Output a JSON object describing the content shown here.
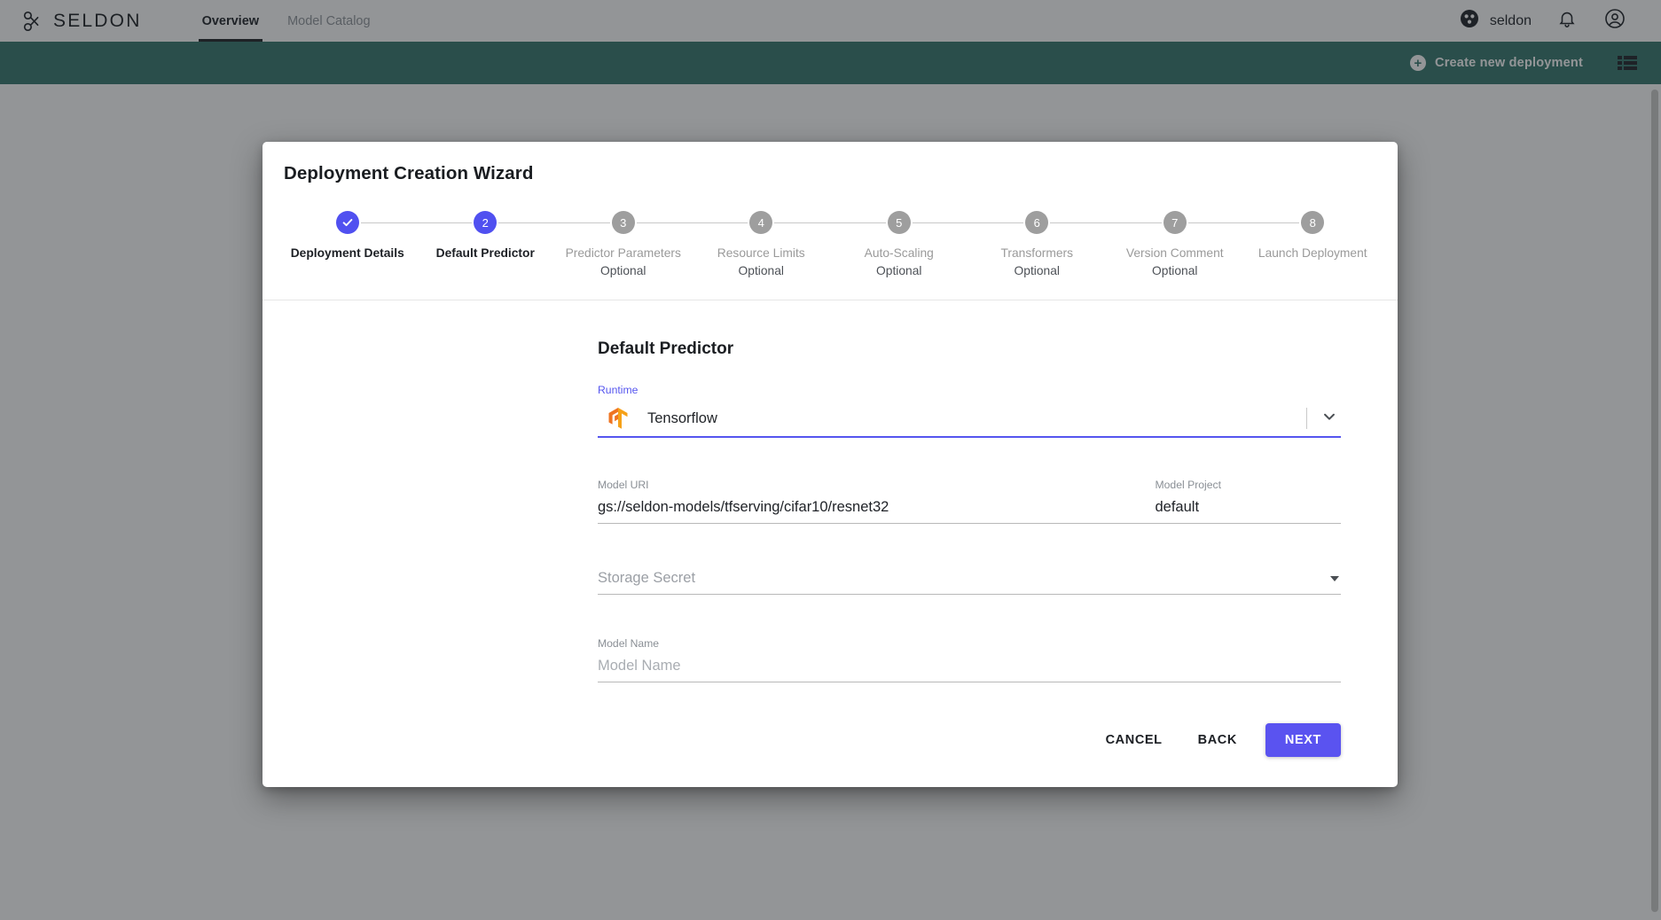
{
  "topbar": {
    "brand": "SELDON",
    "brand_icon": "seldon-logo-icon",
    "nav": [
      {
        "label": "Overview",
        "active": true
      },
      {
        "label": "Model Catalog",
        "active": false
      }
    ],
    "org_name": "seldon",
    "org_icon": "org-avatar-icon",
    "notifications_icon": "bell-icon",
    "account_icon": "account-circle-icon"
  },
  "action_band": {
    "create_label": "Create new deployment",
    "create_icon": "plus-icon",
    "list_view_icon": "list-view-icon",
    "background_color": "#2d7167"
  },
  "modal": {
    "title": "Deployment Creation Wizard",
    "steps": [
      {
        "num": "1",
        "label": "Deployment Details",
        "sub": "",
        "state": "done"
      },
      {
        "num": "2",
        "label": "Default Predictor",
        "sub": "",
        "state": "active"
      },
      {
        "num": "3",
        "label": "Predictor Parameters",
        "sub": "Optional",
        "state": "todo"
      },
      {
        "num": "4",
        "label": "Resource Limits",
        "sub": "Optional",
        "state": "todo"
      },
      {
        "num": "5",
        "label": "Auto-Scaling",
        "sub": "Optional",
        "state": "todo"
      },
      {
        "num": "6",
        "label": "Transformers",
        "sub": "Optional",
        "state": "todo"
      },
      {
        "num": "7",
        "label": "Version Comment",
        "sub": "Optional",
        "state": "todo"
      },
      {
        "num": "8",
        "label": "Launch Deployment",
        "sub": "",
        "state": "todo"
      }
    ],
    "section_title": "Default Predictor",
    "fields": {
      "runtime_label": "Runtime",
      "runtime_value": "Tensorflow",
      "runtime_icon": "tensorflow-logo-icon",
      "runtime_chevron_icon": "chevron-down-icon",
      "model_uri_label": "Model URI",
      "model_uri_value": "gs://seldon-models/tfserving/cifar10/resnet32",
      "model_project_label": "Model Project",
      "model_project_value": "default",
      "storage_secret_placeholder": "Storage Secret",
      "storage_secret_value": "",
      "storage_secret_caret_icon": "caret-down-icon",
      "model_name_label": "Model Name",
      "model_name_placeholder": "Model Name",
      "model_name_value": ""
    },
    "buttons": {
      "cancel": "CANCEL",
      "back": "BACK",
      "next": "NEXT"
    },
    "accent_color": "#5555ef",
    "primary_button_color": "#5a53f0"
  }
}
